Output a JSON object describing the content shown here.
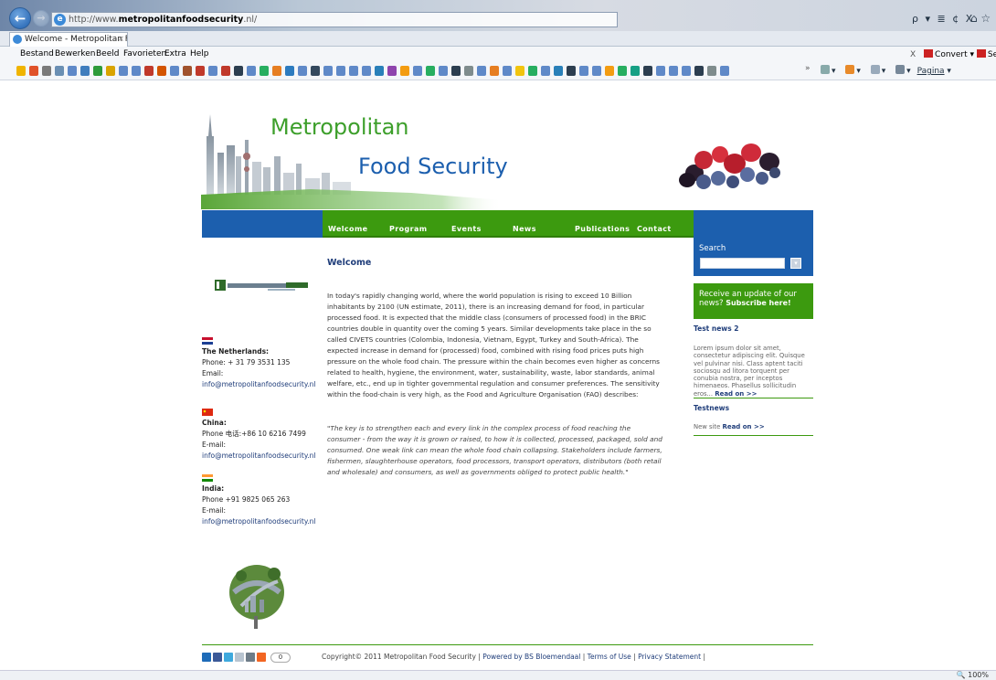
{
  "browser": {
    "url_prefix": "http://www.",
    "url_domain": "metropolitanfoodsecurity",
    "url_suffix": ".nl/",
    "address_controls": "ρ ▾ ≣ ¢ X",
    "tab_title": "Welcome - Metropolitan Fo...",
    "tab_close": "×",
    "menu": [
      "Bestand",
      "Bewerken",
      "Beeld",
      "Favorieten",
      "Extra",
      "Help"
    ],
    "convert_label": "Convert",
    "convert_extra": "Se",
    "pagina_label": "Pagina",
    "zoom": "100%"
  },
  "site": {
    "title_line1": "Metropolitan",
    "title_line2": "Food Security"
  },
  "nav": [
    "Welcome",
    "Program",
    "Events",
    "News",
    "Publications",
    "Contact"
  ],
  "search": {
    "label": "Search",
    "button": "▾"
  },
  "newsletter": {
    "text": "Receive an update of our news?",
    "link": "Subscribe here!"
  },
  "sidebar_news": [
    {
      "title": "Test news 2",
      "body": "Lorem ipsum dolor sit amet, consectetur adipiscing elit. Quisque vel pulvinar nisi. Class aptent taciti sociosqu ad litora torquent per conubia nostra, per inceptos himenaeos. Phasellus sollicitudin eros...",
      "read_more": "Read on >>"
    },
    {
      "title": "Testnews",
      "body": "New site",
      "read_more": "Read on >>"
    }
  ],
  "contacts": [
    {
      "country": "The Netherlands:",
      "phone": "Phone: + 31 79 3531 135",
      "email_label": "Email:",
      "email": "info@metropolitanfoodsecurity.nl"
    },
    {
      "country": "China:",
      "phone": "Phone 电话:+86 10 6216 7499",
      "email_label": "E-mail:",
      "email": "info@metropolitanfoodsecurity.nl"
    },
    {
      "country": "India:",
      "phone": "Phone +91 9825 065 263",
      "email_label": "E-mail:",
      "email": "info@metropolitanfoodsecurity.nl"
    }
  ],
  "content": {
    "title": "Welcome",
    "body": "In today's rapidly changing world, where the world population is rising to exceed 10 Billion inhabitants by 2100 (UN estimate, 2011), there is an increasing demand for food, in particular processed food. It is expected that the middle class (consumers of processed food) in the BRIC countries double in quantity over the coming 5 years. Similar developments take place in the so called CIVETS countries (Colombia, Indonesia, Vietnam, Egypt, Turkey and South-Africa). The expected increase in demand for (processed) food, combined with rising food prices puts high pressure on the whole food chain. The pressure within the chain becomes even higher as concerns related to health, hygiene, the environment, water, sustainability, waste, labor standards, animal welfare, etc., end up in tighter governmental regulation and consumer preferences. The sensitivity within the food-chain is very high, as the Food and Agriculture Organisation (FAO) describes:",
    "quote": "\"The key is to strengthen each and every link in the complex process of food reaching the consumer - from the way it is grown or raised, to how it is collected, processed, packaged, sold and consumed. One weak link can mean the whole food chain collapsing. Stakeholders include farmers, fishermen, slaughterhouse operators, food processors, transport operators, distributors (both retail and wholesale) and consumers, as well as governments obliged to protect public health.\""
  },
  "footer": {
    "share_count": "0",
    "copyright": "Copyright© 2011 Metropolitan Food Security |",
    "powered": "Powered by BS Bloemendaal",
    "terms": "Terms of Use",
    "privacy": "Privacy Statement",
    "sep": "|"
  },
  "colors": {
    "brand_green": "#3c9a0f",
    "brand_blue": "#1c5fae",
    "link_navy": "#1f3d7a"
  }
}
